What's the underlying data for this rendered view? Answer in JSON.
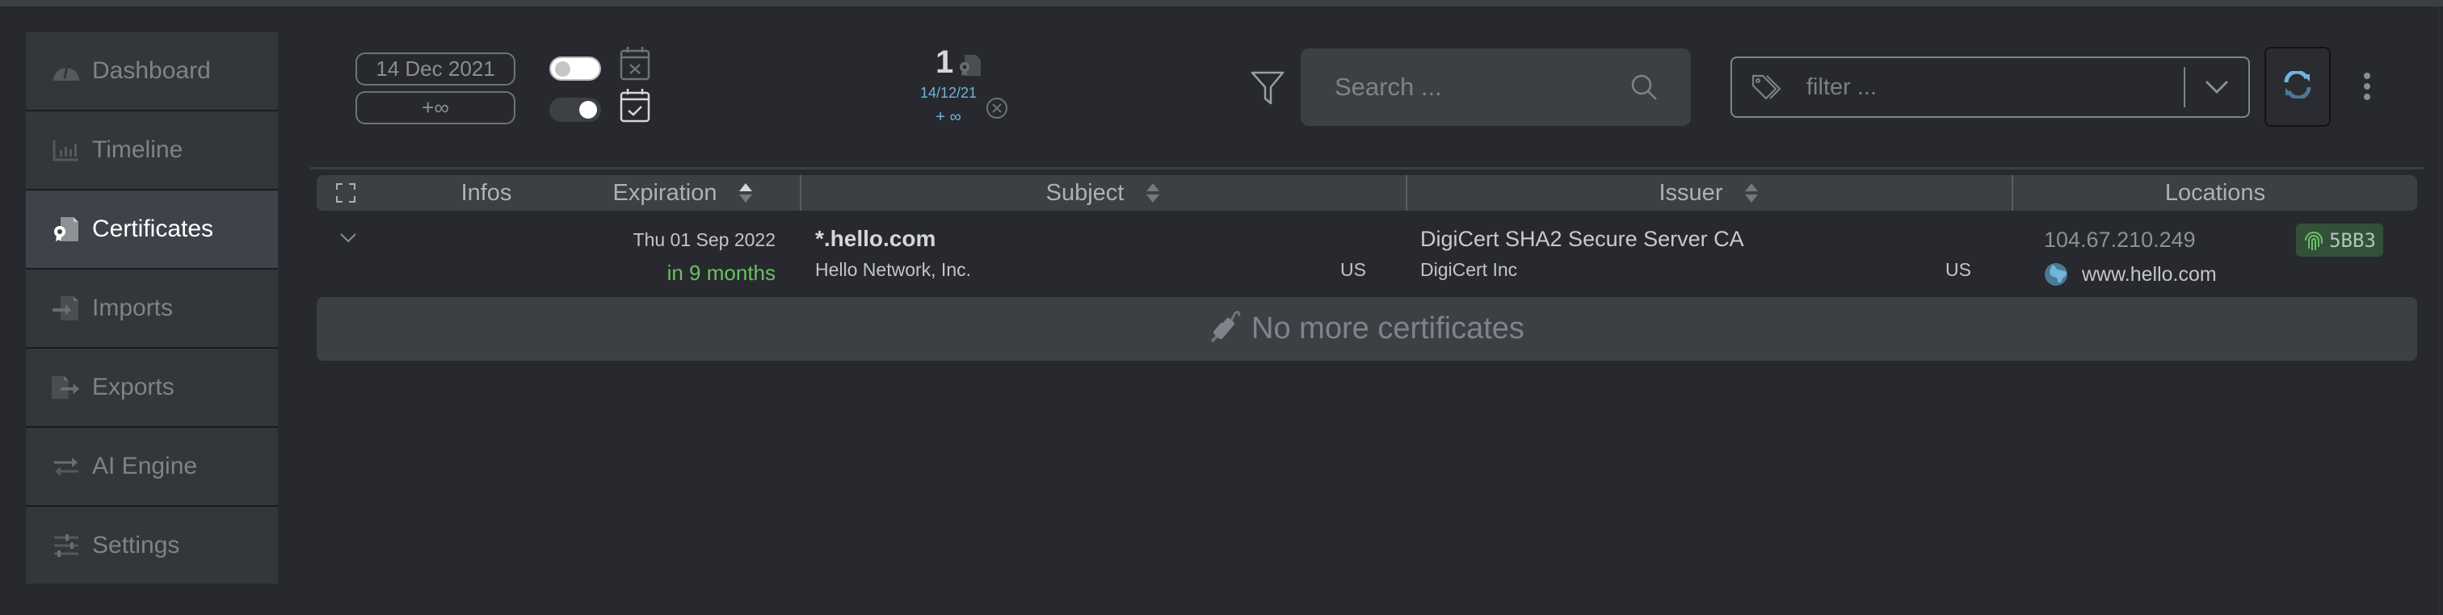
{
  "sidebar": {
    "items": [
      {
        "label": "Dashboard",
        "icon": "gauge-icon",
        "active": false
      },
      {
        "label": "Timeline",
        "icon": "bar-chart-icon",
        "active": false
      },
      {
        "label": "Certificates",
        "icon": "certificate-icon",
        "active": true
      },
      {
        "label": "Imports",
        "icon": "file-import-icon",
        "active": false
      },
      {
        "label": "Exports",
        "icon": "file-export-icon",
        "active": false
      },
      {
        "label": "AI Engine",
        "icon": "exchange-arrows-icon",
        "active": false
      },
      {
        "label": "Settings",
        "icon": "sliders-icon",
        "active": false
      }
    ]
  },
  "date_range": {
    "start": "14 Dec 2021",
    "end": "+∞",
    "start_toggle": false,
    "end_toggle": true
  },
  "counter": {
    "count": "1",
    "date": "14/12/21",
    "range_end": "+ ∞"
  },
  "search": {
    "placeholder": "Search ...",
    "value": ""
  },
  "tag_filter": {
    "placeholder": "filter ...",
    "value": ""
  },
  "colors": {
    "accent_blue": "#6fb5dc",
    "expiry_ok_green": "#6bc162",
    "fingerprint_badge": "#33503a"
  },
  "table": {
    "columns": [
      {
        "label": "Infos",
        "sortable": false
      },
      {
        "label": "Expiration",
        "sortable": true,
        "sort": "asc"
      },
      {
        "label": "Subject",
        "sortable": true
      },
      {
        "label": "Issuer",
        "sortable": true
      },
      {
        "label": "Locations",
        "sortable": false
      }
    ],
    "rows": [
      {
        "expiration_date": "Thu 01 Sep 2022",
        "expiration_relative": "in 9 months",
        "subject_cn": "*.hello.com",
        "subject_org": "Hello Network, Inc.",
        "subject_country": "US",
        "issuer_cn": "DigiCert SHA2 Secure Server CA",
        "issuer_org": "DigiCert Inc",
        "issuer_country": "US",
        "location_ip": "104.67.210.249",
        "location_host": "www.hello.com",
        "fingerprint": "5BB3"
      }
    ],
    "footer": "No more certificates"
  }
}
